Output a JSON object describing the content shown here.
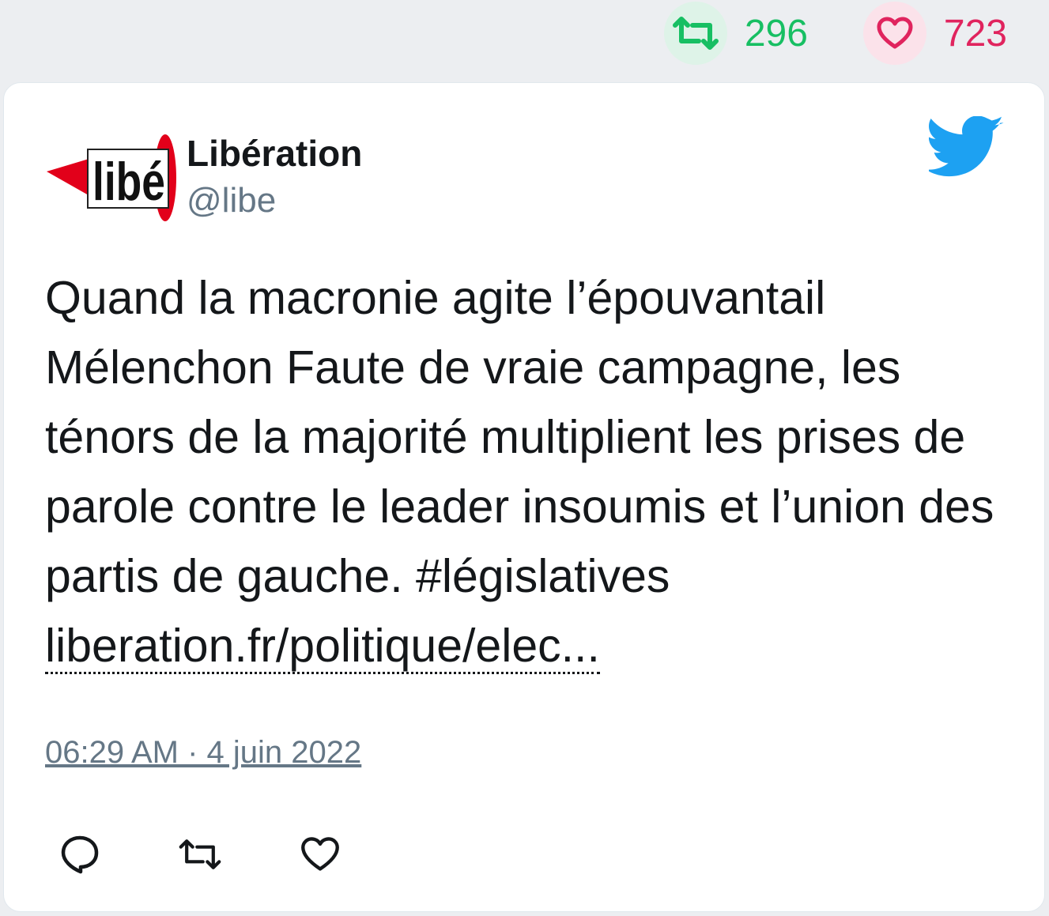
{
  "stats": {
    "retweets": "296",
    "likes": "723"
  },
  "tweet": {
    "author_name": "Libération",
    "author_handle": "@libe",
    "avatar_logo_text": "libé",
    "text": "Quand la macronie agite l’épouvantail Mélenchon Faute de vraie campagne, les ténors de la majorité multiplient les prises de parole contre le leader insoumis et l’union des partis de gauche. #législatives ",
    "link": "liberation.fr/politique/elec...",
    "timestamp": "06:29 AM · 4 juin 2022"
  },
  "icons": {
    "retweet_stat": "retweet-icon",
    "like_stat": "heart-icon",
    "brand": "twitter-bird-icon",
    "reply_action": "reply-icon",
    "retweet_action": "retweet-icon",
    "like_action": "heart-icon"
  },
  "colors": {
    "retweet": "#17bf63",
    "like": "#e0245e",
    "twitter_blue": "#1da1f2",
    "secondary_text": "#657786"
  }
}
